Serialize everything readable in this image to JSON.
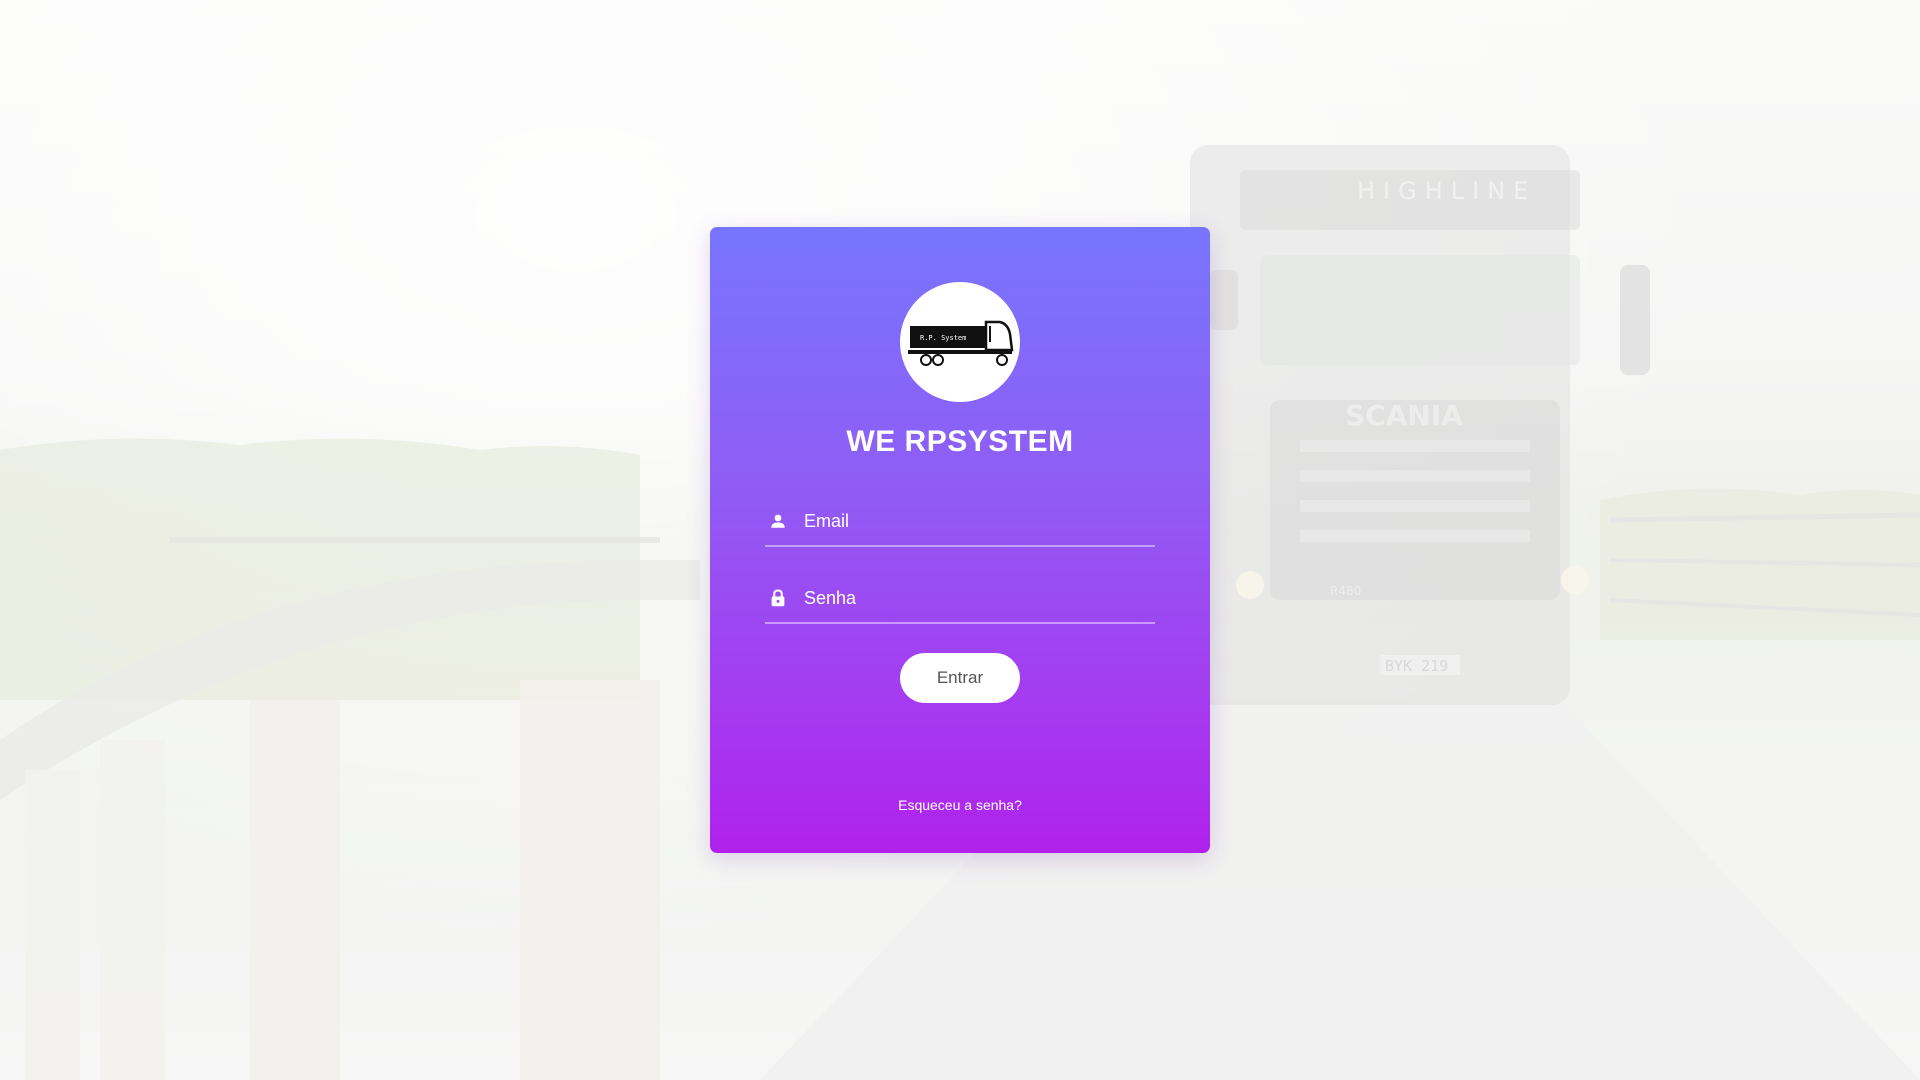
{
  "app": {
    "title": "WE RPSYSTEM"
  },
  "logo": {
    "icon": "truck-icon",
    "text": "R.P. System"
  },
  "form": {
    "email_placeholder": "Email",
    "password_placeholder": "Senha",
    "submit_label": "Entrar",
    "forgot_label": "Esqueceu a senha?"
  },
  "background": {
    "truck_grille_text": "HIGHLINE",
    "truck_brand_text": "SCANIA",
    "truck_model_text": "R480",
    "license_plate": "BYK 219"
  },
  "colors": {
    "card_top": "#7775fe",
    "card_bottom": "#b022ec",
    "button_bg": "#ffffff",
    "button_text": "#555555"
  }
}
